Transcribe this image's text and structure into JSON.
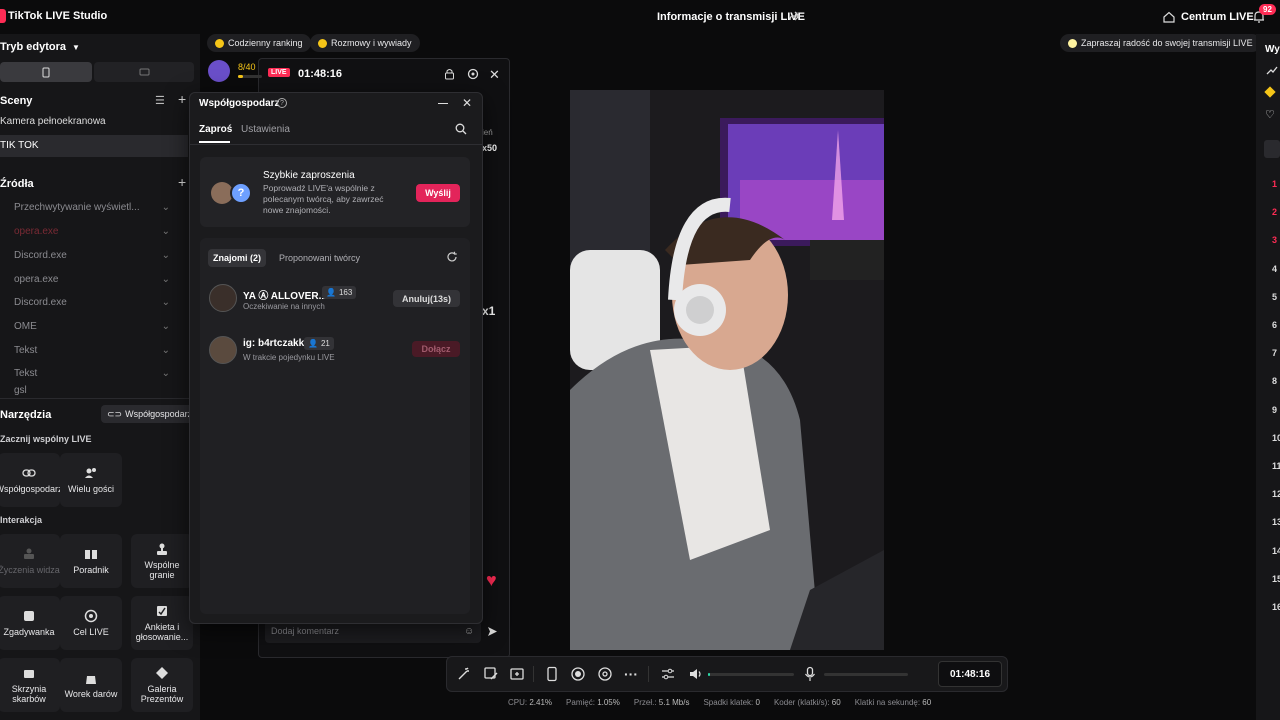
{
  "titlebar": {
    "app_title": "TikTok LIVE Studio",
    "stream_info": "Informacje o transmisji LIVE",
    "centrum": "Centrum LIVE",
    "notifications": "92"
  },
  "sidebar": {
    "mode": "Tryb edytora",
    "scenes_title": "Sceny",
    "scenes": [
      "Kamera pełnoekranowa",
      "TIK TOK"
    ],
    "sources_title": "Źródła",
    "sources": [
      "Przechwytywanie wyświetl...",
      "opera.exe",
      "Discord.exe",
      "opera.exe",
      "Discord.exe",
      "OME",
      "Tekst",
      "Tekst",
      "gsl"
    ],
    "tools_title": "Narzędzia",
    "cohost_button": "Współgospodarz",
    "start_joint_live": "Zacznij wspólny LIVE",
    "joint_tools": [
      "Współgospodarz",
      "Wielu gości"
    ],
    "interaction_title": "Interakcja",
    "interaction_tools": [
      "Życzenia widza",
      "Poradnik",
      "Wspólne granie",
      "Zgadywanka",
      "Cel LIVE",
      "Ankieta i głosowanie...",
      "Skrzynia skarbów",
      "Worek darów",
      "Galeria Prezentów"
    ]
  },
  "chips": {
    "ranking": "Codzienny ranking",
    "talks": "Rozmowy i wywiady",
    "invite_joy": "Zapraszaj radość do swojej transmisji LIVE"
  },
  "live_panel": {
    "progress": "8/40",
    "progress_value": 0.2,
    "live_badge": "LIVE",
    "time": "01:48:16",
    "side_label_1": "ień",
    "side_label_2": "x50",
    "side_label_3": "x1",
    "comment_placeholder": "Dodaj komentarz"
  },
  "popup": {
    "title": "Współgospodarz",
    "tabs": [
      "Zaproś",
      "Ustawienia"
    ],
    "quick_title": "Szybkie zaproszenia",
    "quick_desc": "Poprowadź LIVE'a wspólnie z polecanym twórcą, aby zawrzeć nowe znajomości.",
    "send_button": "Wyślij",
    "list_tabs": [
      "Znajomi (2)",
      "Proponowani twórcy"
    ],
    "friends": [
      {
        "name": "YA Ⓐ ALLOVER.1",
        "followers": "163",
        "status": "Oczekiwanie na innych",
        "action": "Anuluj(13s)"
      },
      {
        "name": "ig: b4rtczakk",
        "followers": "21",
        "status": "W trakcie pojedynku LIVE",
        "action": "Dołącz"
      }
    ]
  },
  "toolbar": {
    "timer": "01:48:16",
    "volume_level": 0.02,
    "mic_level": 0.0
  },
  "stats": {
    "cpu_label": "CPU:",
    "cpu": "2.41%",
    "mem_label": "Pamięć:",
    "mem": "1.05%",
    "bw_label": "Przeł.:",
    "bw": "5.1 Mb/s",
    "drop_label": "Spadki klatek:",
    "drop": "0",
    "enc_label": "Koder (klatki/s):",
    "enc": "60",
    "fps_label": "Klatki na sekundę:",
    "fps": "60"
  },
  "right_col": {
    "header": "Wy",
    "ranks": [
      "1",
      "2",
      "3",
      "4",
      "5",
      "6",
      "7",
      "8",
      "9",
      "10",
      "11",
      "12",
      "13",
      "14",
      "15",
      "16"
    ]
  },
  "colors": {
    "accent": "#fe2c55",
    "bg": "#0b0b0c",
    "panel": "#161618"
  }
}
